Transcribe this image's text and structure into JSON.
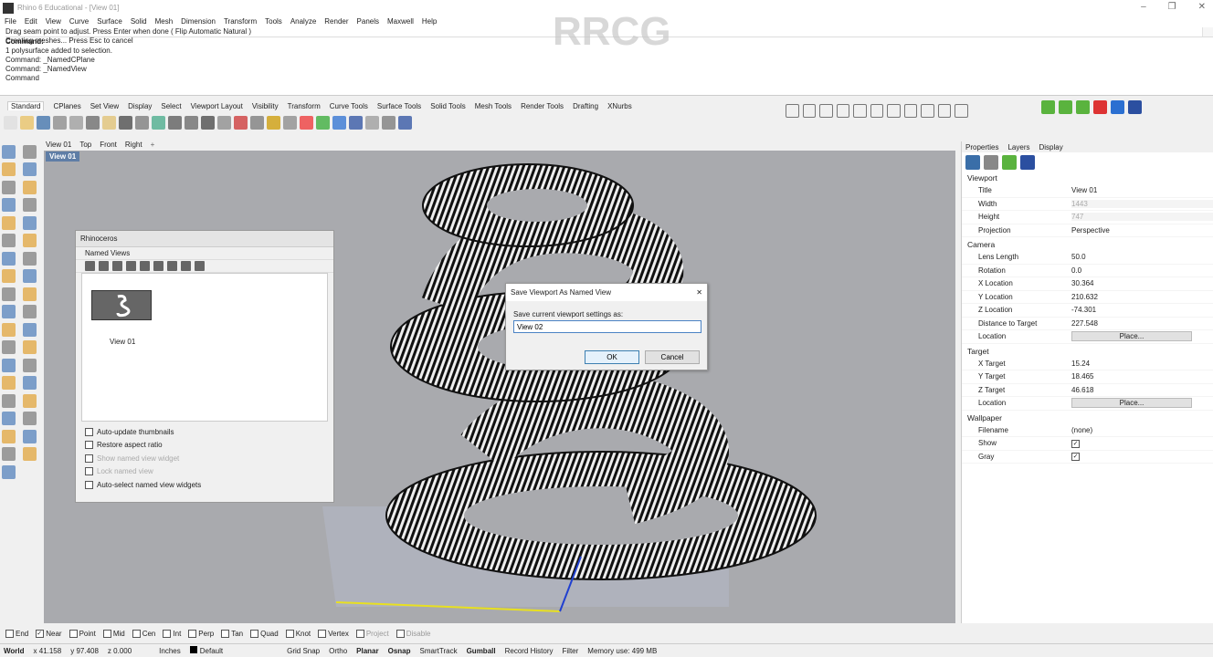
{
  "window": {
    "title": "Rhino 6 Educational - [View 01]"
  },
  "menu": [
    "File",
    "Edit",
    "View",
    "Curve",
    "Surface",
    "Solid",
    "Mesh",
    "Dimension",
    "Transform",
    "Tools",
    "Analyze",
    "Render",
    "Panels",
    "Maxwell",
    "Help"
  ],
  "command_history": [
    "Drag seam point to adjust. Press Enter when done ( Flip  Automatic  Natural )",
    "Creating meshes... Press Esc to cancel",
    "1 polysurface added to selection.",
    "Command: _NamedCPlane",
    "Command: _NamedView",
    "Command"
  ],
  "command_prompt": "Command:",
  "toolbar_tabs": [
    "Standard",
    "CPlanes",
    "Set View",
    "Display",
    "Select",
    "Viewport Layout",
    "Visibility",
    "Transform",
    "Curve Tools",
    "Surface Tools",
    "Solid Tools",
    "Mesh Tools",
    "Render Tools",
    "Drafting",
    "XNurbs"
  ],
  "viewport_tabs": [
    "View 01",
    "Top",
    "Front",
    "Right"
  ],
  "viewport_title": "View 01",
  "named_views_panel": {
    "title": "Rhinoceros",
    "subtitle": "Named Views",
    "thumbnail_label": "View 01",
    "options": [
      {
        "label": "Auto-update thumbnails",
        "checked": false,
        "enabled": true
      },
      {
        "label": "Restore aspect ratio",
        "checked": false,
        "enabled": true
      },
      {
        "label": "Show named view widget",
        "checked": false,
        "enabled": false
      },
      {
        "label": "Lock named view",
        "checked": false,
        "enabled": false
      },
      {
        "label": "Auto-select named view widgets",
        "checked": false,
        "enabled": true
      }
    ]
  },
  "dialog": {
    "title": "Save Viewport As Named View",
    "label": "Save current viewport settings as:",
    "value": "View 02",
    "ok": "OK",
    "cancel": "Cancel"
  },
  "right_panel": {
    "tabs": [
      "Properties",
      "Layers",
      "Display"
    ],
    "viewport_section": "Viewport",
    "viewport": [
      {
        "k": "Title",
        "v": "View 01",
        "grey": false
      },
      {
        "k": "Width",
        "v": "1443",
        "grey": true
      },
      {
        "k": "Height",
        "v": "747",
        "grey": true
      },
      {
        "k": "Projection",
        "v": "Perspective",
        "grey": false
      }
    ],
    "camera_section": "Camera",
    "camera": [
      {
        "k": "Lens Length",
        "v": "50.0"
      },
      {
        "k": "Rotation",
        "v": "0.0"
      },
      {
        "k": "X Location",
        "v": "30.364"
      },
      {
        "k": "Y Location",
        "v": "210.632"
      },
      {
        "k": "Z Location",
        "v": "-74.301"
      },
      {
        "k": "Distance to Target",
        "v": "227.548"
      }
    ],
    "camera_location_label": "Location",
    "place_button": "Place...",
    "target_section": "Target",
    "target": [
      {
        "k": "X Target",
        "v": "15.24"
      },
      {
        "k": "Y Target",
        "v": "18.465"
      },
      {
        "k": "Z Target",
        "v": "46.618"
      }
    ],
    "target_location_label": "Location",
    "wallpaper_section": "Wallpaper",
    "wallpaper": [
      {
        "k": "Filename",
        "v": "(none)"
      },
      {
        "k": "Show",
        "v": "checked"
      },
      {
        "k": "Gray",
        "v": "checked"
      }
    ]
  },
  "osnaps": [
    {
      "label": "End",
      "checked": false
    },
    {
      "label": "Near",
      "checked": true
    },
    {
      "label": "Point",
      "checked": false
    },
    {
      "label": "Mid",
      "checked": false
    },
    {
      "label": "Cen",
      "checked": false
    },
    {
      "label": "Int",
      "checked": false
    },
    {
      "label": "Perp",
      "checked": false
    },
    {
      "label": "Tan",
      "checked": false
    },
    {
      "label": "Quad",
      "checked": false
    },
    {
      "label": "Knot",
      "checked": false
    },
    {
      "label": "Vertex",
      "checked": false
    },
    {
      "label": "Project",
      "checked": false,
      "dim": true
    },
    {
      "label": "Disable",
      "checked": false,
      "dim": true
    }
  ],
  "status": {
    "cplane": "World",
    "x": "x 41.158",
    "y": "y 97.408",
    "z": "z 0.000",
    "units": "Inches",
    "layer": "Default",
    "toggles": [
      "Grid Snap",
      "Ortho",
      "Planar",
      "Osnap",
      "SmartTrack",
      "Gumball",
      "Record History",
      "Filter"
    ],
    "bold_toggles": [
      "Planar",
      "Osnap",
      "Gumball"
    ],
    "memory": "Memory use: 499 MB"
  },
  "watermark": "RRCG"
}
